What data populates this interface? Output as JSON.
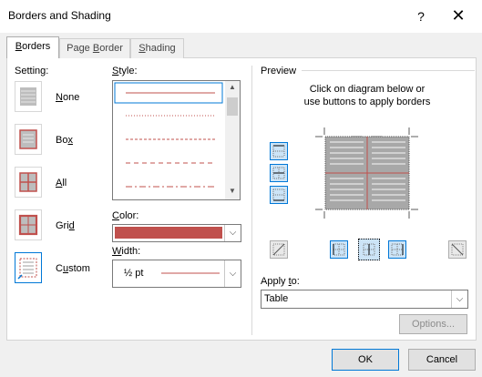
{
  "window": {
    "title": "Borders and Shading",
    "help_label": "?",
    "close_label": "✕"
  },
  "tabs": [
    {
      "label": "Borders",
      "underline": "B",
      "rest": "orders",
      "active": true
    },
    {
      "label": "Page Border",
      "pre": "Page ",
      "underline": "B",
      "rest": "order",
      "active": false
    },
    {
      "label": "Shading",
      "underline": "S",
      "rest": "hading",
      "active": false
    }
  ],
  "setting": {
    "label": "Setting:",
    "options": [
      {
        "label": "None",
        "underline": "N",
        "rest": "one"
      },
      {
        "label": "Box",
        "pre": "Bo",
        "underline": "x",
        "rest": ""
      },
      {
        "label": "All",
        "underline": "A",
        "rest": "ll"
      },
      {
        "label": "Grid",
        "pre": "Gri",
        "underline": "d",
        "rest": ""
      },
      {
        "label": "Custom",
        "pre": "C",
        "underline": "u",
        "rest": "stom",
        "selected": true
      }
    ]
  },
  "style": {
    "label_u": "S",
    "label_rest": "tyle:",
    "line_styles": [
      "solid",
      "dotted",
      "dashed",
      "dashed-wide",
      "dash-dot"
    ]
  },
  "color": {
    "label_u": "C",
    "label_rest": "olor:",
    "value": "#c0504d"
  },
  "width": {
    "label_u": "W",
    "label_rest": "idth:",
    "value": "½ pt"
  },
  "preview": {
    "label": "Preview",
    "instruction_line1": "Click on diagram below or",
    "instruction_line2": "use buttons to apply borders"
  },
  "apply_to": {
    "label_pre": "Apply ",
    "label_u": "t",
    "label_rest": "o:",
    "value": "Table"
  },
  "buttons": {
    "options": "Options...",
    "ok": "OK",
    "cancel": "Cancel"
  },
  "colors": {
    "accent": "#0078d7",
    "border_line": "#c0504d",
    "cell_text": "#d0d0d0"
  }
}
